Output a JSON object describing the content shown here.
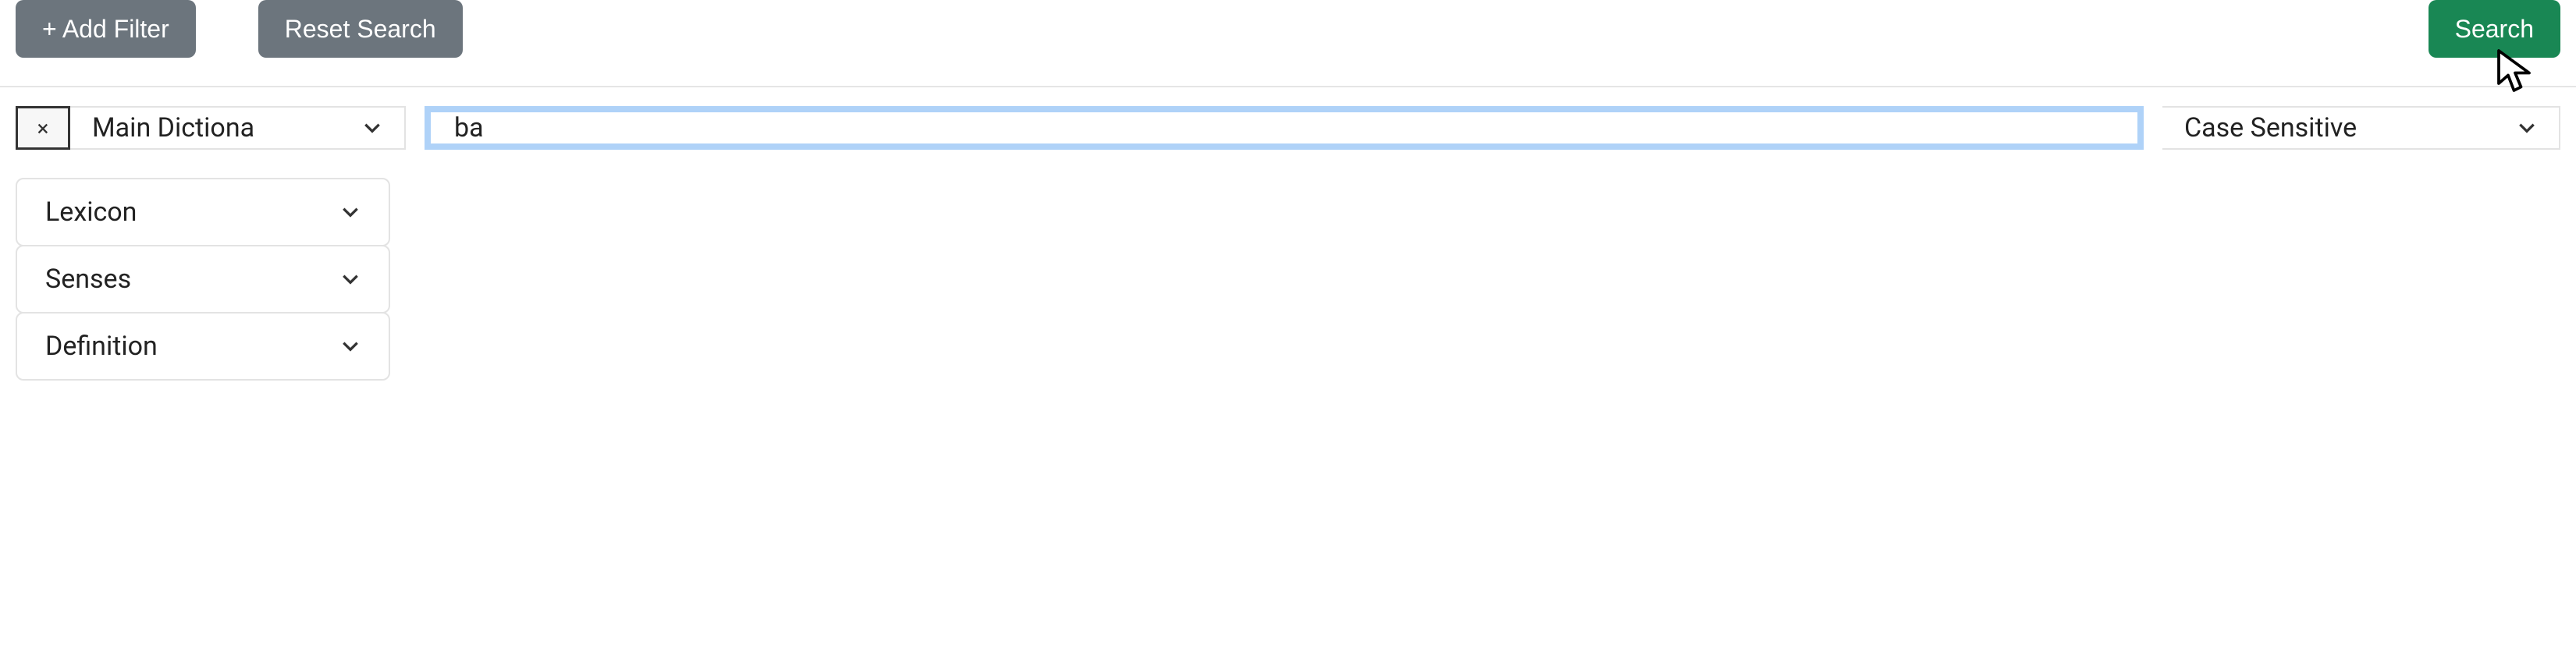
{
  "toolbar": {
    "add_filter_label": "+ Add Filter",
    "reset_search_label": "Reset Search",
    "search_label": "Search"
  },
  "filter_row": {
    "remove_glyph": "×",
    "field_selected": "Main Dictiona",
    "search_value": "ba",
    "case_option_selected": "Case Sensitive"
  },
  "side_panels": [
    {
      "label": "Lexicon"
    },
    {
      "label": "Senses"
    },
    {
      "label": "Definition"
    }
  ]
}
